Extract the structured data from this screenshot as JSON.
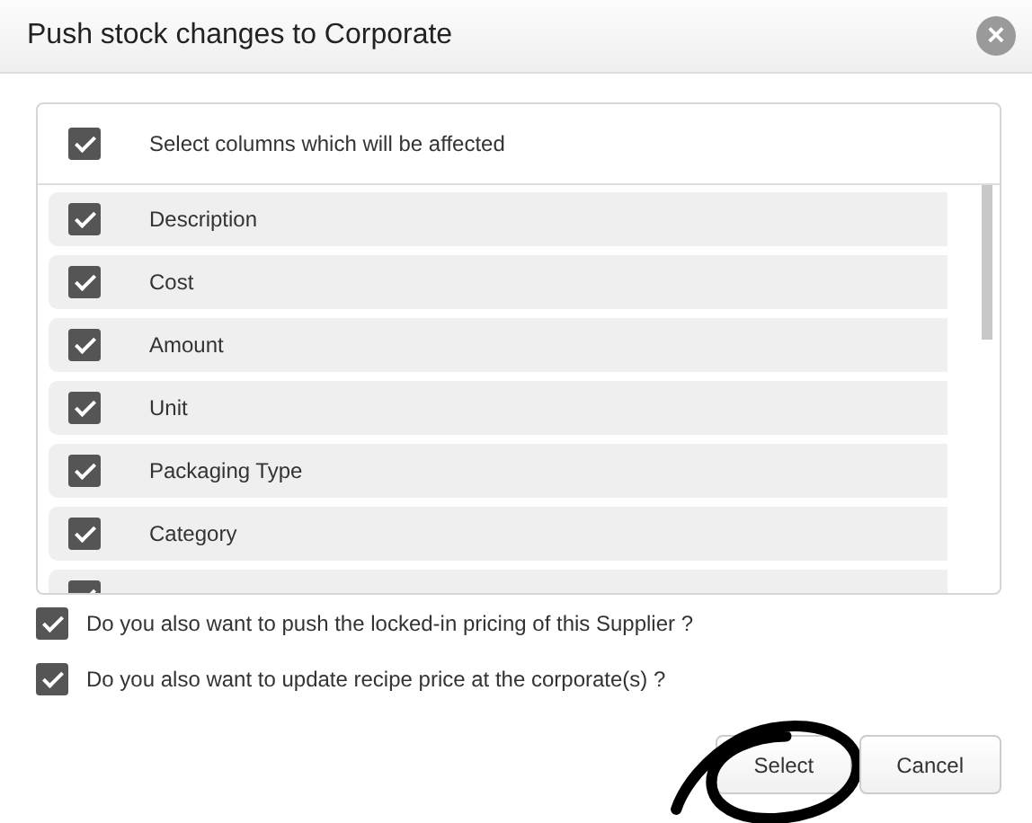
{
  "dialog": {
    "title": "Push stock changes to Corporate",
    "close": "×"
  },
  "columns_panel": {
    "header": {
      "label": "Select columns which will be affected",
      "checked": true
    },
    "items": [
      {
        "label": "Description",
        "checked": true
      },
      {
        "label": "Cost",
        "checked": true
      },
      {
        "label": "Amount",
        "checked": true
      },
      {
        "label": "Unit",
        "checked": true
      },
      {
        "label": "Packaging Type",
        "checked": true
      },
      {
        "label": "Category",
        "checked": true
      },
      {
        "checked": true
      }
    ]
  },
  "options": [
    {
      "label": "Do you also want to push the locked-in pricing of this Supplier ?",
      "checked": true
    },
    {
      "label": "Do you also want to update recipe price at the corporate(s) ?",
      "checked": true
    }
  ],
  "buttons": [
    {
      "label": "Select",
      "circled": true
    },
    {
      "label": "Cancel",
      "circled": false
    }
  ]
}
